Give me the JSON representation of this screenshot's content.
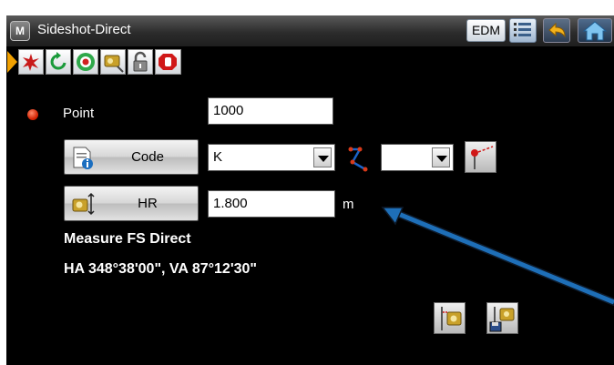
{
  "window": {
    "app_icon_letter": "M",
    "title": "Sideshot-Direct",
    "edm_label": "EDM"
  },
  "icons": {
    "toolbar": [
      "play-arrow-icon",
      "red-star-icon",
      "rotate-icon",
      "target-icon",
      "prism-icon",
      "unlock-icon",
      "stop-hand-icon"
    ],
    "titlebar": [
      "list-icon",
      "back-arrow-icon",
      "home-icon"
    ]
  },
  "form": {
    "point_label": "Point",
    "point_value": "1000",
    "code_button": "Code",
    "code_value": "K",
    "code2_value": "",
    "hr_button": "HR",
    "hr_value": "1.800",
    "hr_unit": "m"
  },
  "status": {
    "measure_text": "Measure FS Direct",
    "angles_text": "HA 348°38'00\", VA 87°12'30\""
  },
  "colors": {
    "accent_arrow": "#f0a000",
    "point_dot": "#d22000",
    "callout_arrow": "#1e6fb8"
  }
}
